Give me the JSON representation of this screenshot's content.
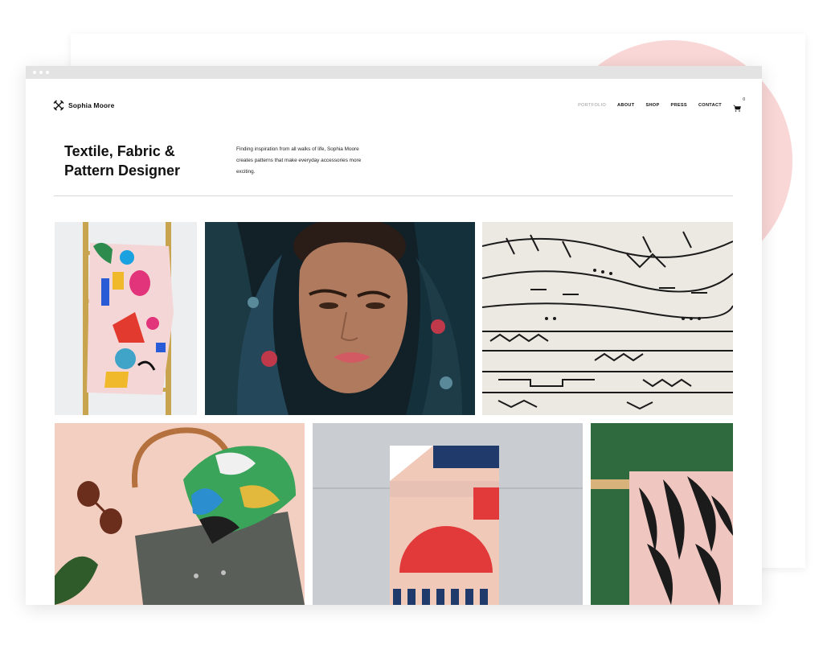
{
  "site": {
    "brand_name": "Sophia Moore",
    "brand_icon": "woven-x-logo-icon"
  },
  "nav": {
    "items": [
      {
        "label": "PORTFOLIO",
        "active": true
      },
      {
        "label": "ABOUT",
        "active": false
      },
      {
        "label": "SHOP",
        "active": false
      },
      {
        "label": "PRESS",
        "active": false
      },
      {
        "label": "CONTACT",
        "active": false
      }
    ],
    "cart_icon": "cart-icon",
    "cart_count": "0"
  },
  "hero": {
    "title": "Textile, Fabric & Pattern Designer",
    "description": "Finding inspiration from all walks of life, Sophia Moore creates patterns that make everyday accessories more exciting."
  },
  "gallery": [
    {
      "subject": "Patterned blanket on a gold ladder"
    },
    {
      "subject": "Woman wrapped in floral fabric"
    },
    {
      "subject": "Stacked mudcloth textiles"
    },
    {
      "subject": "Tote bag with silk scarf and sunglasses"
    },
    {
      "subject": "Geometric towel hanging on a wall"
    },
    {
      "subject": "Palm print fabric on a green wall"
    }
  ],
  "colors": {
    "accent_circle": "#f9d0d0",
    "text": "#111111",
    "muted_nav": "#999999",
    "chrome_bar": "#e3e3e3"
  }
}
